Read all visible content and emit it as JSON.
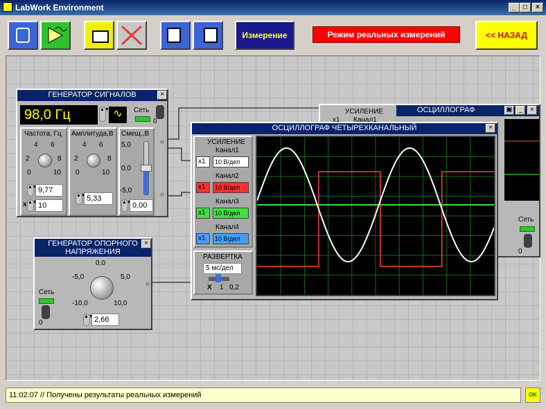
{
  "app": {
    "title": "LabWork Environment"
  },
  "toolbar": {
    "measure_label": "Измерение",
    "mode_label": "Режим реальных измерений",
    "back_label": "<< НАЗАД"
  },
  "generator": {
    "title": "ГЕНЕРАТОР СИГНАЛОВ",
    "freq_display": "98,0 Гц",
    "net_label": "Сеть",
    "net_value": "0",
    "freq_label": "Частота, Гц",
    "amp_label": "Амплитуда,В",
    "offset_label": "Смещ.,В",
    "freq_scale": [
      "4",
      "6",
      "2",
      "8",
      "0",
      "10"
    ],
    "amp_scale": [
      "4",
      "6",
      "2",
      "8",
      "0",
      "10"
    ],
    "offset_scale": [
      "5,0",
      "0,0",
      "-5,0"
    ],
    "freq_value": "9,77",
    "mult_prefix": "x",
    "mult_value": "10",
    "amp_value": "5,33",
    "offset_value": "0,00"
  },
  "reference": {
    "title_line1": "ГЕНЕРАТОР ОПОРНОГО",
    "title_line2": "НАПРЯЖЕНИЯ",
    "net_label": "Сеть",
    "net_value": "0",
    "scale": [
      "0,0",
      "-5,0",
      "5,0",
      "-10,0",
      "10,0"
    ],
    "value": "2,66"
  },
  "osc_back": {
    "title": "ОСЦИЛЛОГРАФ",
    "gain_label": "УСИЛЕНИЕ",
    "x1": "х1",
    "ch1": "Канал1",
    "net_label": "Сеть",
    "net_value": "0"
  },
  "osc4": {
    "title": "ОСЦИЛЛОГРАФ ЧЕТЫРЕХКАНАЛЬНЫЙ",
    "gain_label": "УСИЛЕНИЕ",
    "channels": [
      {
        "name": "Канал1",
        "mult": "х1",
        "scale": "10 В/дел",
        "color": "#ffffff"
      },
      {
        "name": "Канал2",
        "mult": "х1",
        "scale": "10 В/дел",
        "color": "#ff3030"
      },
      {
        "name": "Канал3",
        "mult": "х1",
        "scale": "10 В/дел",
        "color": "#40e040"
      },
      {
        "name": "Канал4",
        "mult": "х1",
        "scale": "10 В/дел",
        "color": "#40a0ff"
      }
    ],
    "sweep_label": "РАЗВЕРТКА",
    "sweep_value": "5 мс/дел",
    "sweep_x": "X",
    "sweep_min": "1",
    "sweep_max": "0,2"
  },
  "status": {
    "text": "11:02:07 // Получены результаты реальных измерений",
    "ok": "OK"
  },
  "colors": {
    "title_bg": "#0a246a",
    "mode_red": "#ff0000",
    "back_yellow": "#ffff00",
    "measure_blue": "#1a1a8a"
  }
}
